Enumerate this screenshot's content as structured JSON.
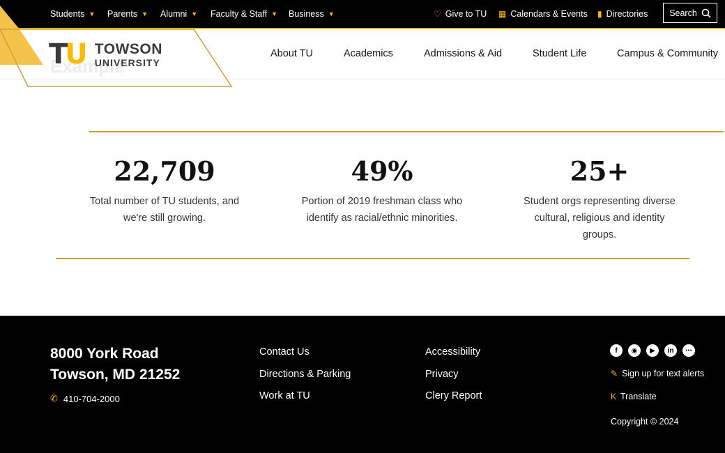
{
  "audience_nav": [
    "Students",
    "Parents",
    "Alumni",
    "Faculty & Staff",
    "Business"
  ],
  "utility_nav": {
    "give": "Give to TU",
    "calendars": "Calendars & Events",
    "directories": "Directories",
    "search": "Search"
  },
  "logo": {
    "mark_t": "T",
    "mark_u": "U",
    "line1": "TOWSON",
    "line2": "UNIVERSITY"
  },
  "ghost_text": "Example",
  "main_nav": [
    "About TU",
    "Academics",
    "Admissions & Aid",
    "Student Life",
    "Campus & Community"
  ],
  "stats": [
    {
      "value": "22,709",
      "desc_line1": "Total number of TU students, and",
      "desc_line2": "we're still growing.",
      "desc_line3": ""
    },
    {
      "value": "49%",
      "desc_line1": "Portion of 2019 freshman class who",
      "desc_line2": "identify as racial/ethnic minorities.",
      "desc_line3": ""
    },
    {
      "value": "25+",
      "desc_line1": "Student orgs representing diverse",
      "desc_line2": "cultural, religious and identity",
      "desc_line3": "groups."
    }
  ],
  "footer": {
    "address_line1": "8000 York Road",
    "address_line2": "Towson, MD 21252",
    "phone": "410-704-2000",
    "links_col1": [
      "Contact Us",
      "Directions & Parking",
      "Work at TU"
    ],
    "links_col2": [
      "Accessibility",
      "Privacy",
      "Clery Report"
    ],
    "social_icons": [
      "facebook-icon",
      "instagram-icon",
      "youtube-icon",
      "linkedin-icon",
      "more-icon"
    ],
    "text_alerts": "Sign up for text alerts",
    "translate": "Translate",
    "copyright": "Copyright  © 2024"
  },
  "colors": {
    "gold": "#ffbb00",
    "rule": "#c8a13a",
    "black": "#000000"
  }
}
